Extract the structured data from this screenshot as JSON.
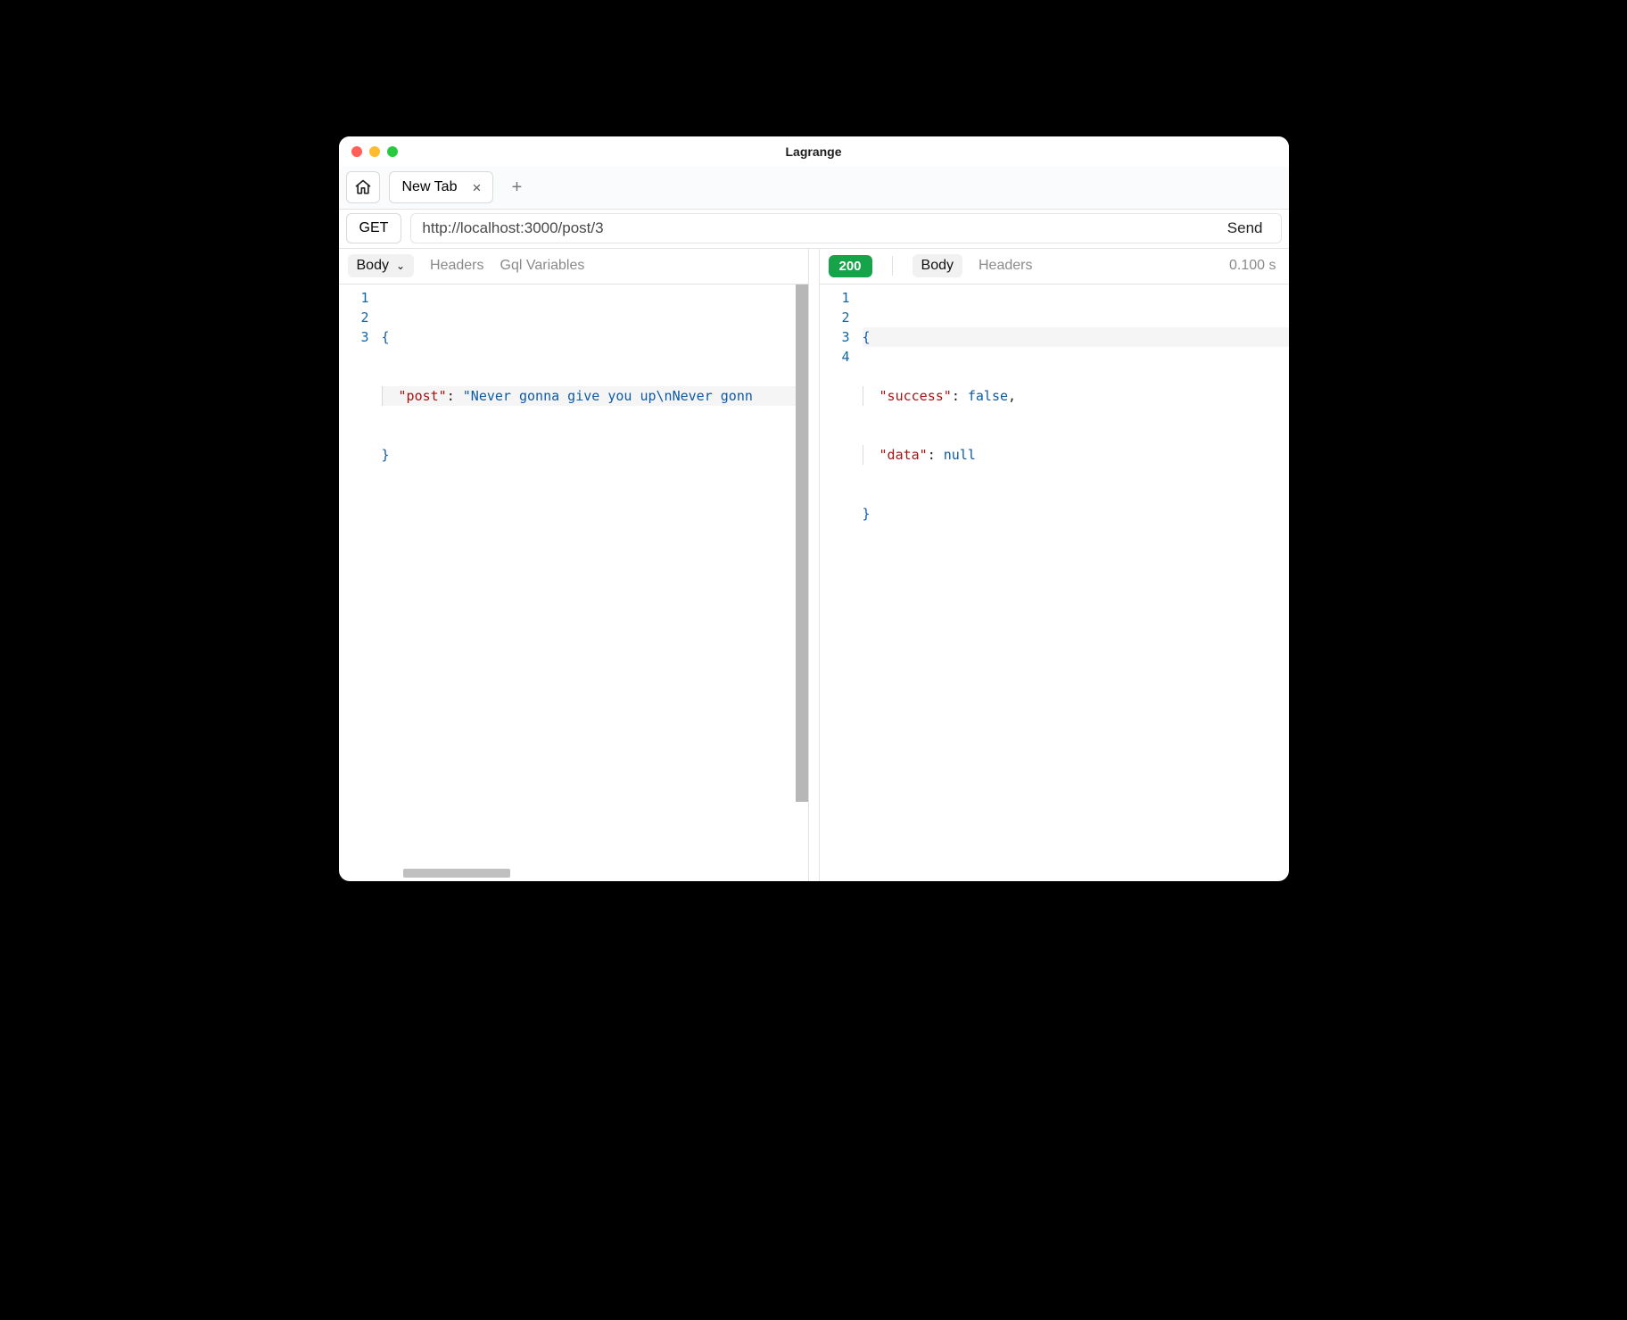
{
  "app_title": "Lagrange",
  "tabs": {
    "home_icon": "home",
    "items": [
      {
        "label": "New Tab"
      }
    ]
  },
  "request": {
    "method": "GET",
    "url": "http://localhost:3000/post/3",
    "send_label": "Send"
  },
  "request_pane_tabs": {
    "body": "Body",
    "headers": "Headers",
    "gql": "Gql Variables"
  },
  "response_pane_tabs": {
    "body": "Body",
    "headers": "Headers"
  },
  "response": {
    "status": "200",
    "timing": "0.100 s"
  },
  "request_body": {
    "lines": [
      "1",
      "2",
      "3"
    ],
    "l1": "{",
    "l2_key": "\"post\"",
    "l2_colon": ":",
    "l2_val": " \"Never gonna give you up\\nNever gonn",
    "l3": "}"
  },
  "response_body": {
    "lines": [
      "1",
      "2",
      "3",
      "4"
    ],
    "l1": "{",
    "l2_key": "\"success\"",
    "l2_colon": ":",
    "l2_val": " false",
    "l2_comma": ",",
    "l3_key": "\"data\"",
    "l3_colon": ":",
    "l3_val": " null",
    "l4": "}"
  }
}
